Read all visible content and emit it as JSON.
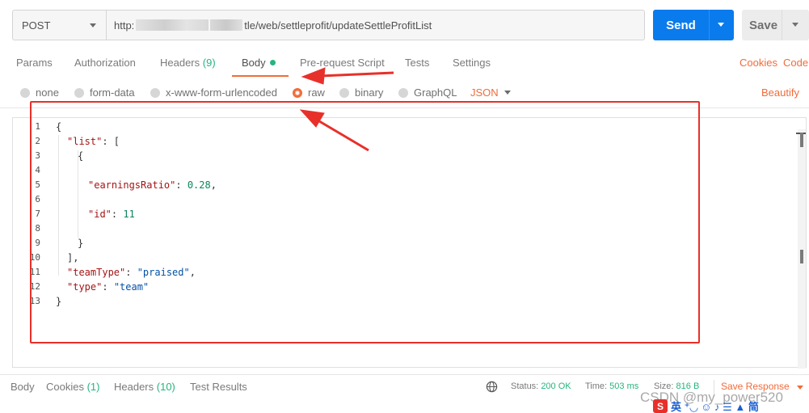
{
  "request": {
    "method": "POST",
    "url_prefix": "http:",
    "url_suffix": "tle/web/settleprofit/updateSettleProfitList",
    "send_label": "Send",
    "save_label": "Save"
  },
  "tabs": [
    {
      "label": "Params"
    },
    {
      "label": "Authorization"
    },
    {
      "label": "Headers",
      "count": "(9)"
    },
    {
      "label": "Body"
    },
    {
      "label": "Pre-request Script"
    },
    {
      "label": "Tests"
    },
    {
      "label": "Settings"
    }
  ],
  "links": {
    "cookies": "Cookies",
    "code": "Code"
  },
  "body_types": [
    {
      "label": "none",
      "selected": false
    },
    {
      "label": "form-data",
      "selected": false
    },
    {
      "label": "x-www-form-urlencoded",
      "selected": false
    },
    {
      "label": "raw",
      "selected": true
    },
    {
      "label": "binary",
      "selected": false
    },
    {
      "label": "GraphQL",
      "selected": false
    }
  ],
  "language": "JSON",
  "beautify": "Beautify",
  "editor": {
    "line_numbers": [
      "1",
      "2",
      "3",
      "4",
      "5",
      "6",
      "7",
      "8",
      "9",
      "10",
      "11",
      "12",
      "13"
    ],
    "lines": [
      "{",
      "\"list\": [",
      "{",
      "",
      "\"earningsRatio\": 0.28,",
      "",
      "\"id\": 11",
      "",
      "}",
      "],",
      "\"teamType\": \"praised\",",
      "\"type\": \"team\"",
      "}"
    ]
  },
  "response": {
    "tabs": [
      {
        "label": "Body"
      },
      {
        "label": "Cookies",
        "count": "(1)"
      },
      {
        "label": "Headers",
        "count": "(10)"
      },
      {
        "label": "Test Results"
      }
    ],
    "status_label": "Status:",
    "status_value": "200 OK",
    "time_label": "Time:",
    "time_value": "503 ms",
    "size_label": "Size:",
    "size_value": "816 B",
    "save_response": "Save Response"
  },
  "watermark": "CSDN @my_power520",
  "ime": {
    "logo": "S",
    "chars": "英 ⁺◡ ☺ ♪ ☰ ▲ 简"
  },
  "colors": {
    "accent": "#f26b3a",
    "send": "#097bed",
    "success": "#26b47f",
    "annotation": "#e8302a"
  }
}
